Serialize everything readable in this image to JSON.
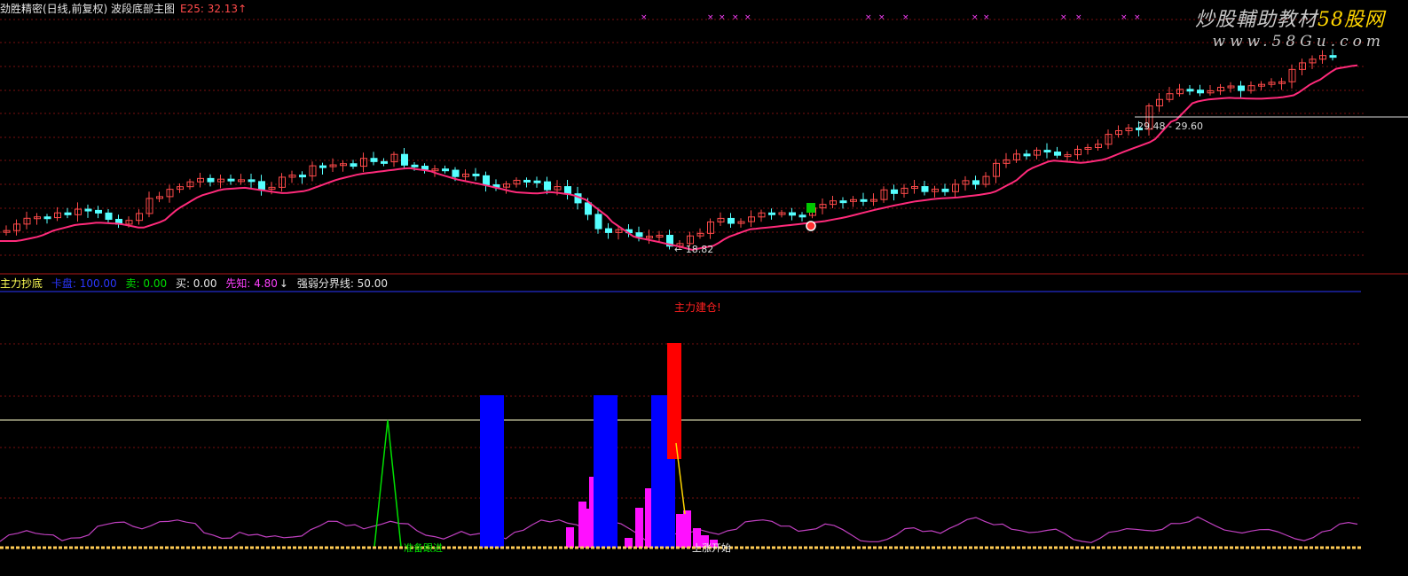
{
  "upper_panel": {
    "indicator_name": "劲胜精密(日线,前复权) 波段底部主图",
    "ma_label": "E25: 32.13",
    "ma_arrow": "↑",
    "low_marker": "18.82",
    "range_label": "29.48 - 29.60",
    "colors": {
      "up": "#ff4a4a",
      "down": "#55ffff",
      "ma": "#ff2a7a",
      "grid": "#7a1010",
      "cross": "#ff40ff"
    }
  },
  "watermark": {
    "line1_prefix": "炒股輔助教材",
    "line1_highlight": "58股网",
    "line2": "www.58Gu.com"
  },
  "lower_panel": {
    "title": "主力抄底",
    "items": [
      {
        "key": "holdings",
        "label": "卡盘: 100.00",
        "color": "#2a36ff"
      },
      {
        "key": "sell",
        "label": "卖: 0.00",
        "color": "#00e000"
      },
      {
        "key": "buy",
        "label": "买: 0.00",
        "color": "#e6e6e6"
      },
      {
        "key": "foreknow",
        "label": "先知: 4.80",
        "color": "#ff40ff"
      }
    ],
    "foreknow_arrow": "↓",
    "strength_line_label": "强弱分界线: 50.00",
    "warning": "主力建仓!",
    "green_annotation": "准备跟进",
    "white_annotation": "上涨开始"
  }
}
